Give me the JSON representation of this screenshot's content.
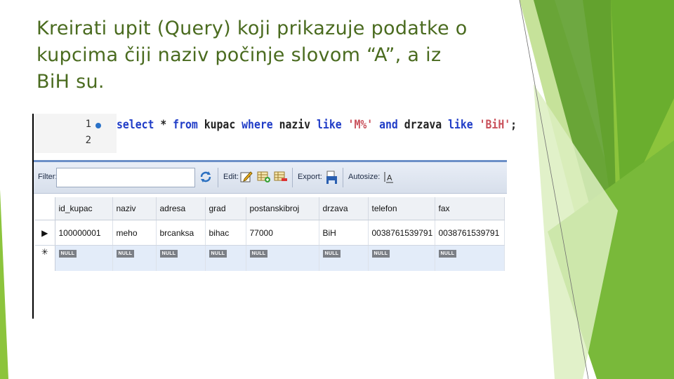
{
  "slide": {
    "title": "Kreirati upit (Query) koji prikazuje podatke o\nkupcima čiji naziv počinje slovom “A”, a iz\nBiH su.",
    "colors": {
      "green_dark": "#4e9a22",
      "green_mid": "#8cc43c",
      "green_light": "#c6e29a",
      "title": "#4a6b1f"
    }
  },
  "editor": {
    "line_numbers": [
      "1",
      "2"
    ],
    "tokens": [
      {
        "text": "select",
        "kind": "kw"
      },
      {
        "text": " * ",
        "kind": "id"
      },
      {
        "text": "from",
        "kind": "kw"
      },
      {
        "text": " kupac ",
        "kind": "id"
      },
      {
        "text": "where",
        "kind": "kw"
      },
      {
        "text": " naziv ",
        "kind": "id"
      },
      {
        "text": "like",
        "kind": "kw"
      },
      {
        "text": " ",
        "kind": "id"
      },
      {
        "text": "'M%'",
        "kind": "str"
      },
      {
        "text": " ",
        "kind": "id"
      },
      {
        "text": "and",
        "kind": "kw"
      },
      {
        "text": " drzava ",
        "kind": "id"
      },
      {
        "text": "like",
        "kind": "kw"
      },
      {
        "text": " ",
        "kind": "id"
      },
      {
        "text": "'BiH'",
        "kind": "str"
      },
      {
        "text": ";",
        "kind": "id"
      }
    ]
  },
  "toolbar": {
    "filter_label": "Filter:",
    "filter_value": "",
    "edit_label": "Edit:",
    "export_label": "Export:",
    "autosize_label": "Autosize:",
    "icons": [
      "refresh-icon",
      "edit-row-icon",
      "add-row-icon",
      "delete-row-icon",
      "export-save-icon",
      "autosize-icon"
    ]
  },
  "grid": {
    "columns": [
      "id_kupac",
      "naziv",
      "adresa",
      "grad",
      "postanskibroj",
      "drzava",
      "telefon",
      "fax"
    ],
    "rows": [
      [
        "100000001",
        "meho",
        "brcanksa",
        "bihac",
        "77000",
        "BiH",
        "0038761539791",
        "0038761539791"
      ]
    ],
    "null_label": "NULL",
    "row_indicator": "▶",
    "new_row_indicator": "✳"
  }
}
